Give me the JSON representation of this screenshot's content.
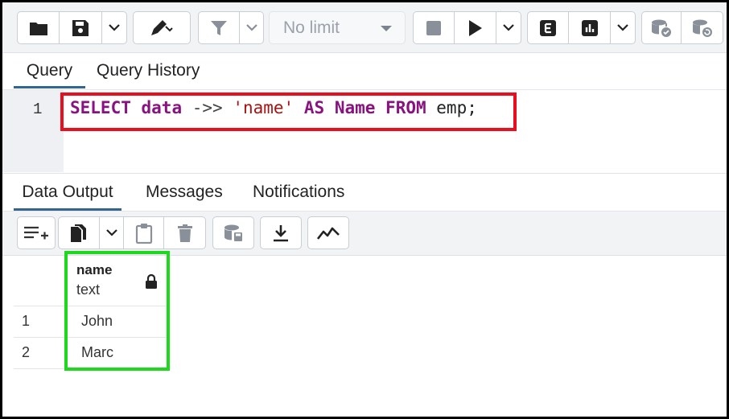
{
  "toolbar": {
    "icons": [
      "folder-icon",
      "save-icon",
      "chevron-down-icon",
      "edit-icon",
      "chevron-down-icon",
      "filter-icon",
      "chevron-down-icon",
      "stop-icon",
      "play-icon",
      "chevron-down-icon",
      "explain-icon",
      "explain-analyze-icon",
      "chevron-down-icon",
      "commit-icon",
      "rollback-icon"
    ],
    "limit_value": "No limit"
  },
  "query_tabs": [
    "Query",
    "Query History"
  ],
  "editor": {
    "line_number": "1",
    "tokens": {
      "select": "SELECT",
      "data": "data",
      "op": "->>",
      "str": "'name'",
      "as": "AS",
      "alias": "Name",
      "from": "FROM",
      "table": "emp;"
    }
  },
  "output_tabs": [
    "Data Output",
    "Messages",
    "Notifications"
  ],
  "output_toolbar": {
    "icons": [
      "add-row-icon",
      "copy-icon",
      "chevron-down-icon",
      "paste-icon",
      "delete-icon",
      "save-data-icon",
      "download-icon",
      "graph-icon"
    ]
  },
  "grid": {
    "columns": [
      {
        "name": "name",
        "type": "text"
      }
    ],
    "rows": [
      {
        "num": "1",
        "name": "John"
      },
      {
        "num": "2",
        "name": "Marc"
      }
    ]
  },
  "colors": {
    "highlight_query": "#e8101e",
    "highlight_result": "#1ed81e",
    "tab_active": "#326690"
  }
}
